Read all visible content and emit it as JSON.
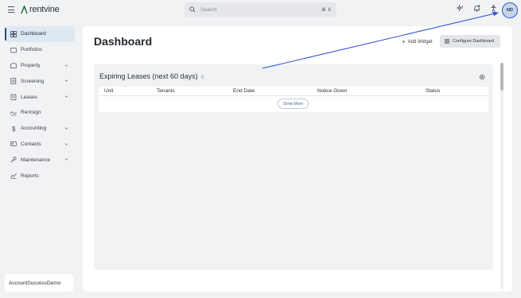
{
  "brand": {
    "name": "rentvine"
  },
  "search": {
    "placeholder": "Search",
    "shortcut": "⌘ K"
  },
  "user": {
    "initials": "ND"
  },
  "top_icons": [
    "sparkle-icon",
    "bell-icon",
    "accessibility-icon"
  ],
  "sidebar": {
    "items": [
      {
        "label": "Dashboard",
        "icon": "grid-icon",
        "active": true,
        "chevron": false
      },
      {
        "label": "Portfolios",
        "icon": "folder-icon",
        "active": false,
        "chevron": false
      },
      {
        "label": "Property",
        "icon": "building-icon",
        "active": false,
        "chevron": true
      },
      {
        "label": "Screening",
        "icon": "document-search-icon",
        "active": false,
        "chevron": true
      },
      {
        "label": "Leases",
        "icon": "clipboard-icon",
        "active": false,
        "chevron": true
      },
      {
        "label": "Rentsign",
        "icon": "signature-icon",
        "active": false,
        "chevron": false
      },
      {
        "label": "Accounting",
        "icon": "dollar-icon",
        "active": false,
        "chevron": true
      },
      {
        "label": "Contacts",
        "icon": "contact-card-icon",
        "active": false,
        "chevron": true
      },
      {
        "label": "Maintenance",
        "icon": "wrench-icon",
        "active": false,
        "chevron": true
      },
      {
        "label": "Reports",
        "icon": "chart-icon",
        "active": false,
        "chevron": false
      }
    ],
    "account_label": "AccountSuccessDemo"
  },
  "main": {
    "title": "Dashboard",
    "add_widget_label": "Add Widget",
    "configure_label": "Configure Dashboard",
    "widget": {
      "title": "Expiring Leases (next 60 days)",
      "count": "0",
      "columns": [
        "Unit",
        "Tenants",
        "End Date",
        "Notice Given",
        "Status"
      ],
      "show_more_label": "Show More"
    }
  },
  "colors": {
    "accent": "#2b5ad1",
    "active_nav_bg": "#dde8f3",
    "link": "#3b6f99"
  }
}
